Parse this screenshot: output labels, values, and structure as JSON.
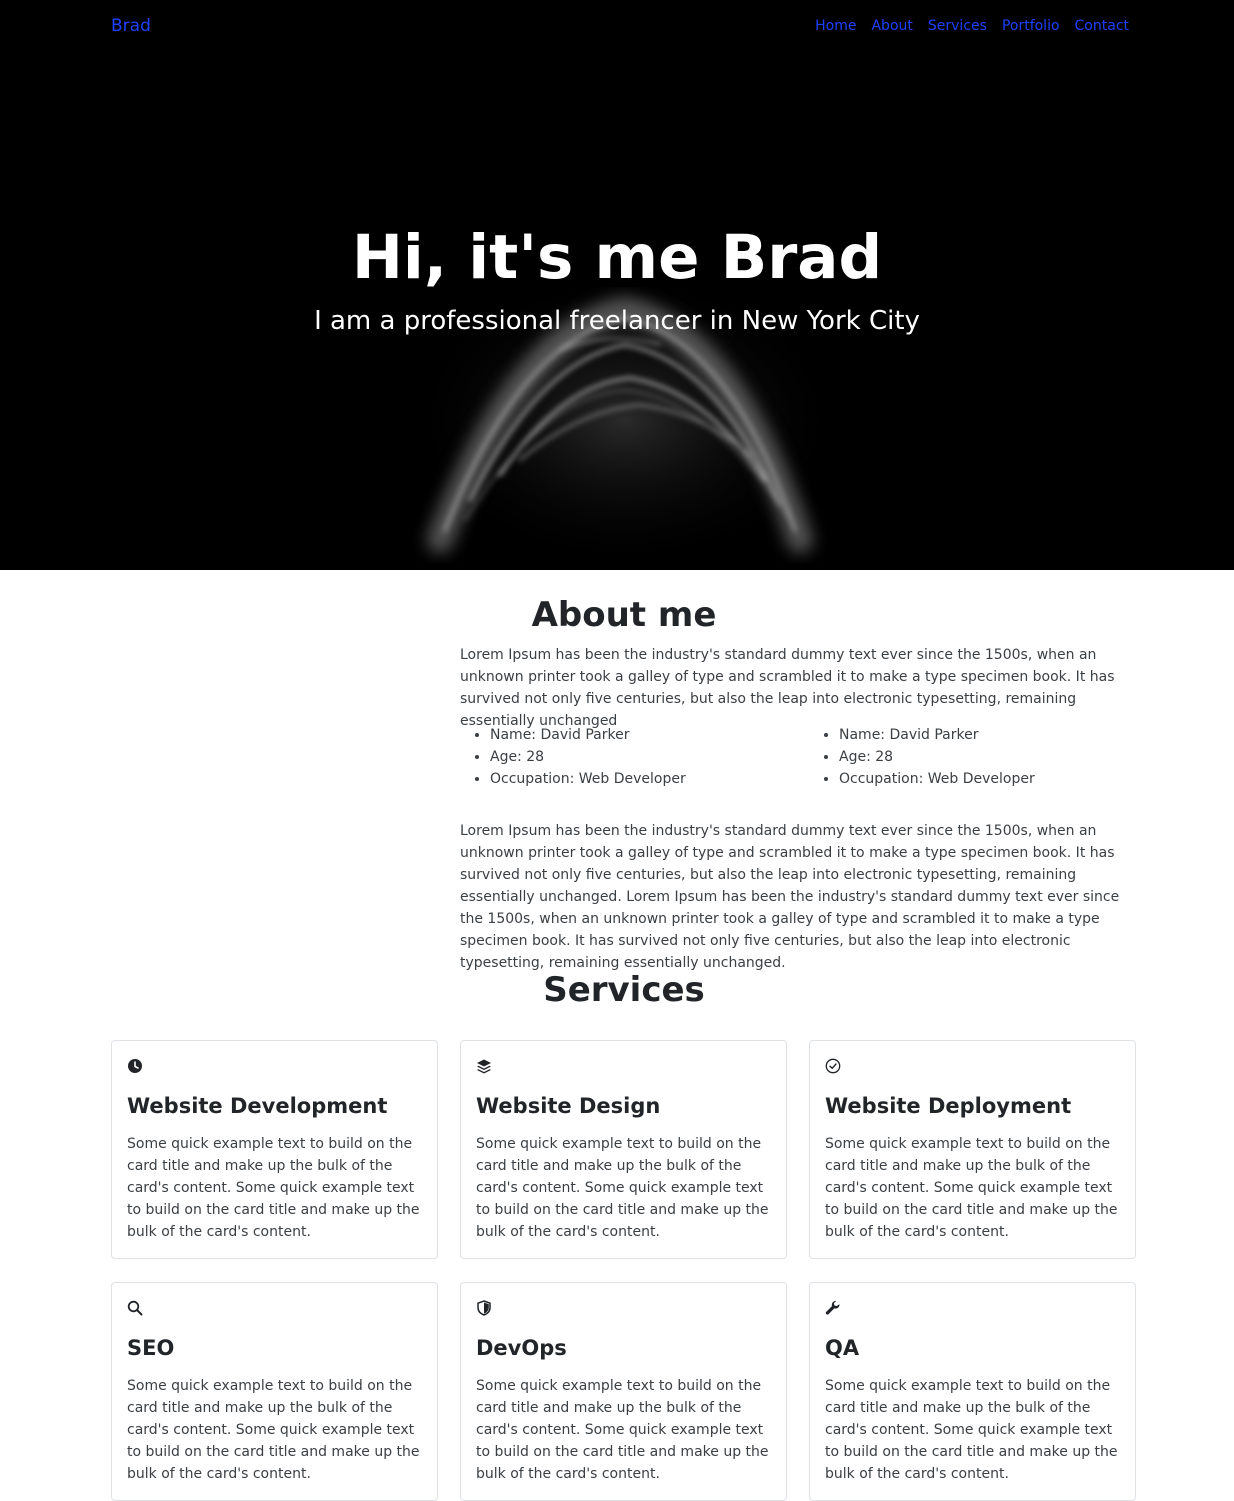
{
  "nav": {
    "brand": "Brad",
    "links": [
      "Home",
      "About",
      "Services",
      "Portfolio",
      "Contact"
    ]
  },
  "hero": {
    "title": "Hi, it's me Brad",
    "subtitle": "I am a professional freelancer in New York City"
  },
  "about": {
    "title": "About me",
    "paragraph1": "Lorem Ipsum has been the industry's standard dummy text ever since the 1500s, when an unknown printer took a galley of type and scrambled it to make a type specimen book. It has survived not only five centuries, but also the leap into electronic typesetting, remaining essentially unchanged",
    "list_left": [
      "Name: David Parker",
      "Age: 28",
      "Occupation: Web Developer"
    ],
    "list_right": [
      "Name: David Parker",
      "Age: 28",
      "Occupation: Web Developer"
    ],
    "paragraph2": "Lorem Ipsum has been the industry's standard dummy text ever since the 1500s, when an unknown printer took a galley of type and scrambled it to make a type specimen book. It has survived not only five centuries, but also the leap into electronic typesetting, remaining essentially unchanged. Lorem Ipsum has been the industry's standard dummy text ever since the 1500s, when an unknown printer took a galley of type and scrambled it to make a type specimen book. It has survived not only five centuries, but also the leap into electronic typesetting, remaining essentially unchanged."
  },
  "services": {
    "title": "Services",
    "cards": [
      {
        "icon": "clock-icon",
        "title": "Website Development",
        "text": "Some quick example text to build on the card title and make up the bulk of the card's content. Some quick example text to build on the card title and make up the bulk of the card's content."
      },
      {
        "icon": "layers-icon",
        "title": "Website Design",
        "text": "Some quick example text to build on the card title and make up the bulk of the card's content. Some quick example text to build on the card title and make up the bulk of the card's content."
      },
      {
        "icon": "check-circle-icon",
        "title": "Website Deployment",
        "text": "Some quick example text to build on the card title and make up the bulk of the card's content. Some quick example text to build on the card title and make up the bulk of the card's content."
      },
      {
        "icon": "search-icon",
        "title": "SEO",
        "text": "Some quick example text to build on the card title and make up the bulk of the card's content. Some quick example text to build on the card title and make up the bulk of the card's content."
      },
      {
        "icon": "shield-icon",
        "title": "DevOps",
        "text": "Some quick example text to build on the card title and make up the bulk of the card's content. Some quick example text to build on the card title and make up the bulk of the card's content."
      },
      {
        "icon": "wrench-icon",
        "title": "QA",
        "text": "Some quick example text to build on the card title and make up the bulk of the card's content. Some quick example text to build on the card title and make up the bulk of the card's content."
      }
    ]
  },
  "colors": {
    "link": "#1e40ff",
    "hero_bg": "#000000",
    "text": "#212529"
  }
}
